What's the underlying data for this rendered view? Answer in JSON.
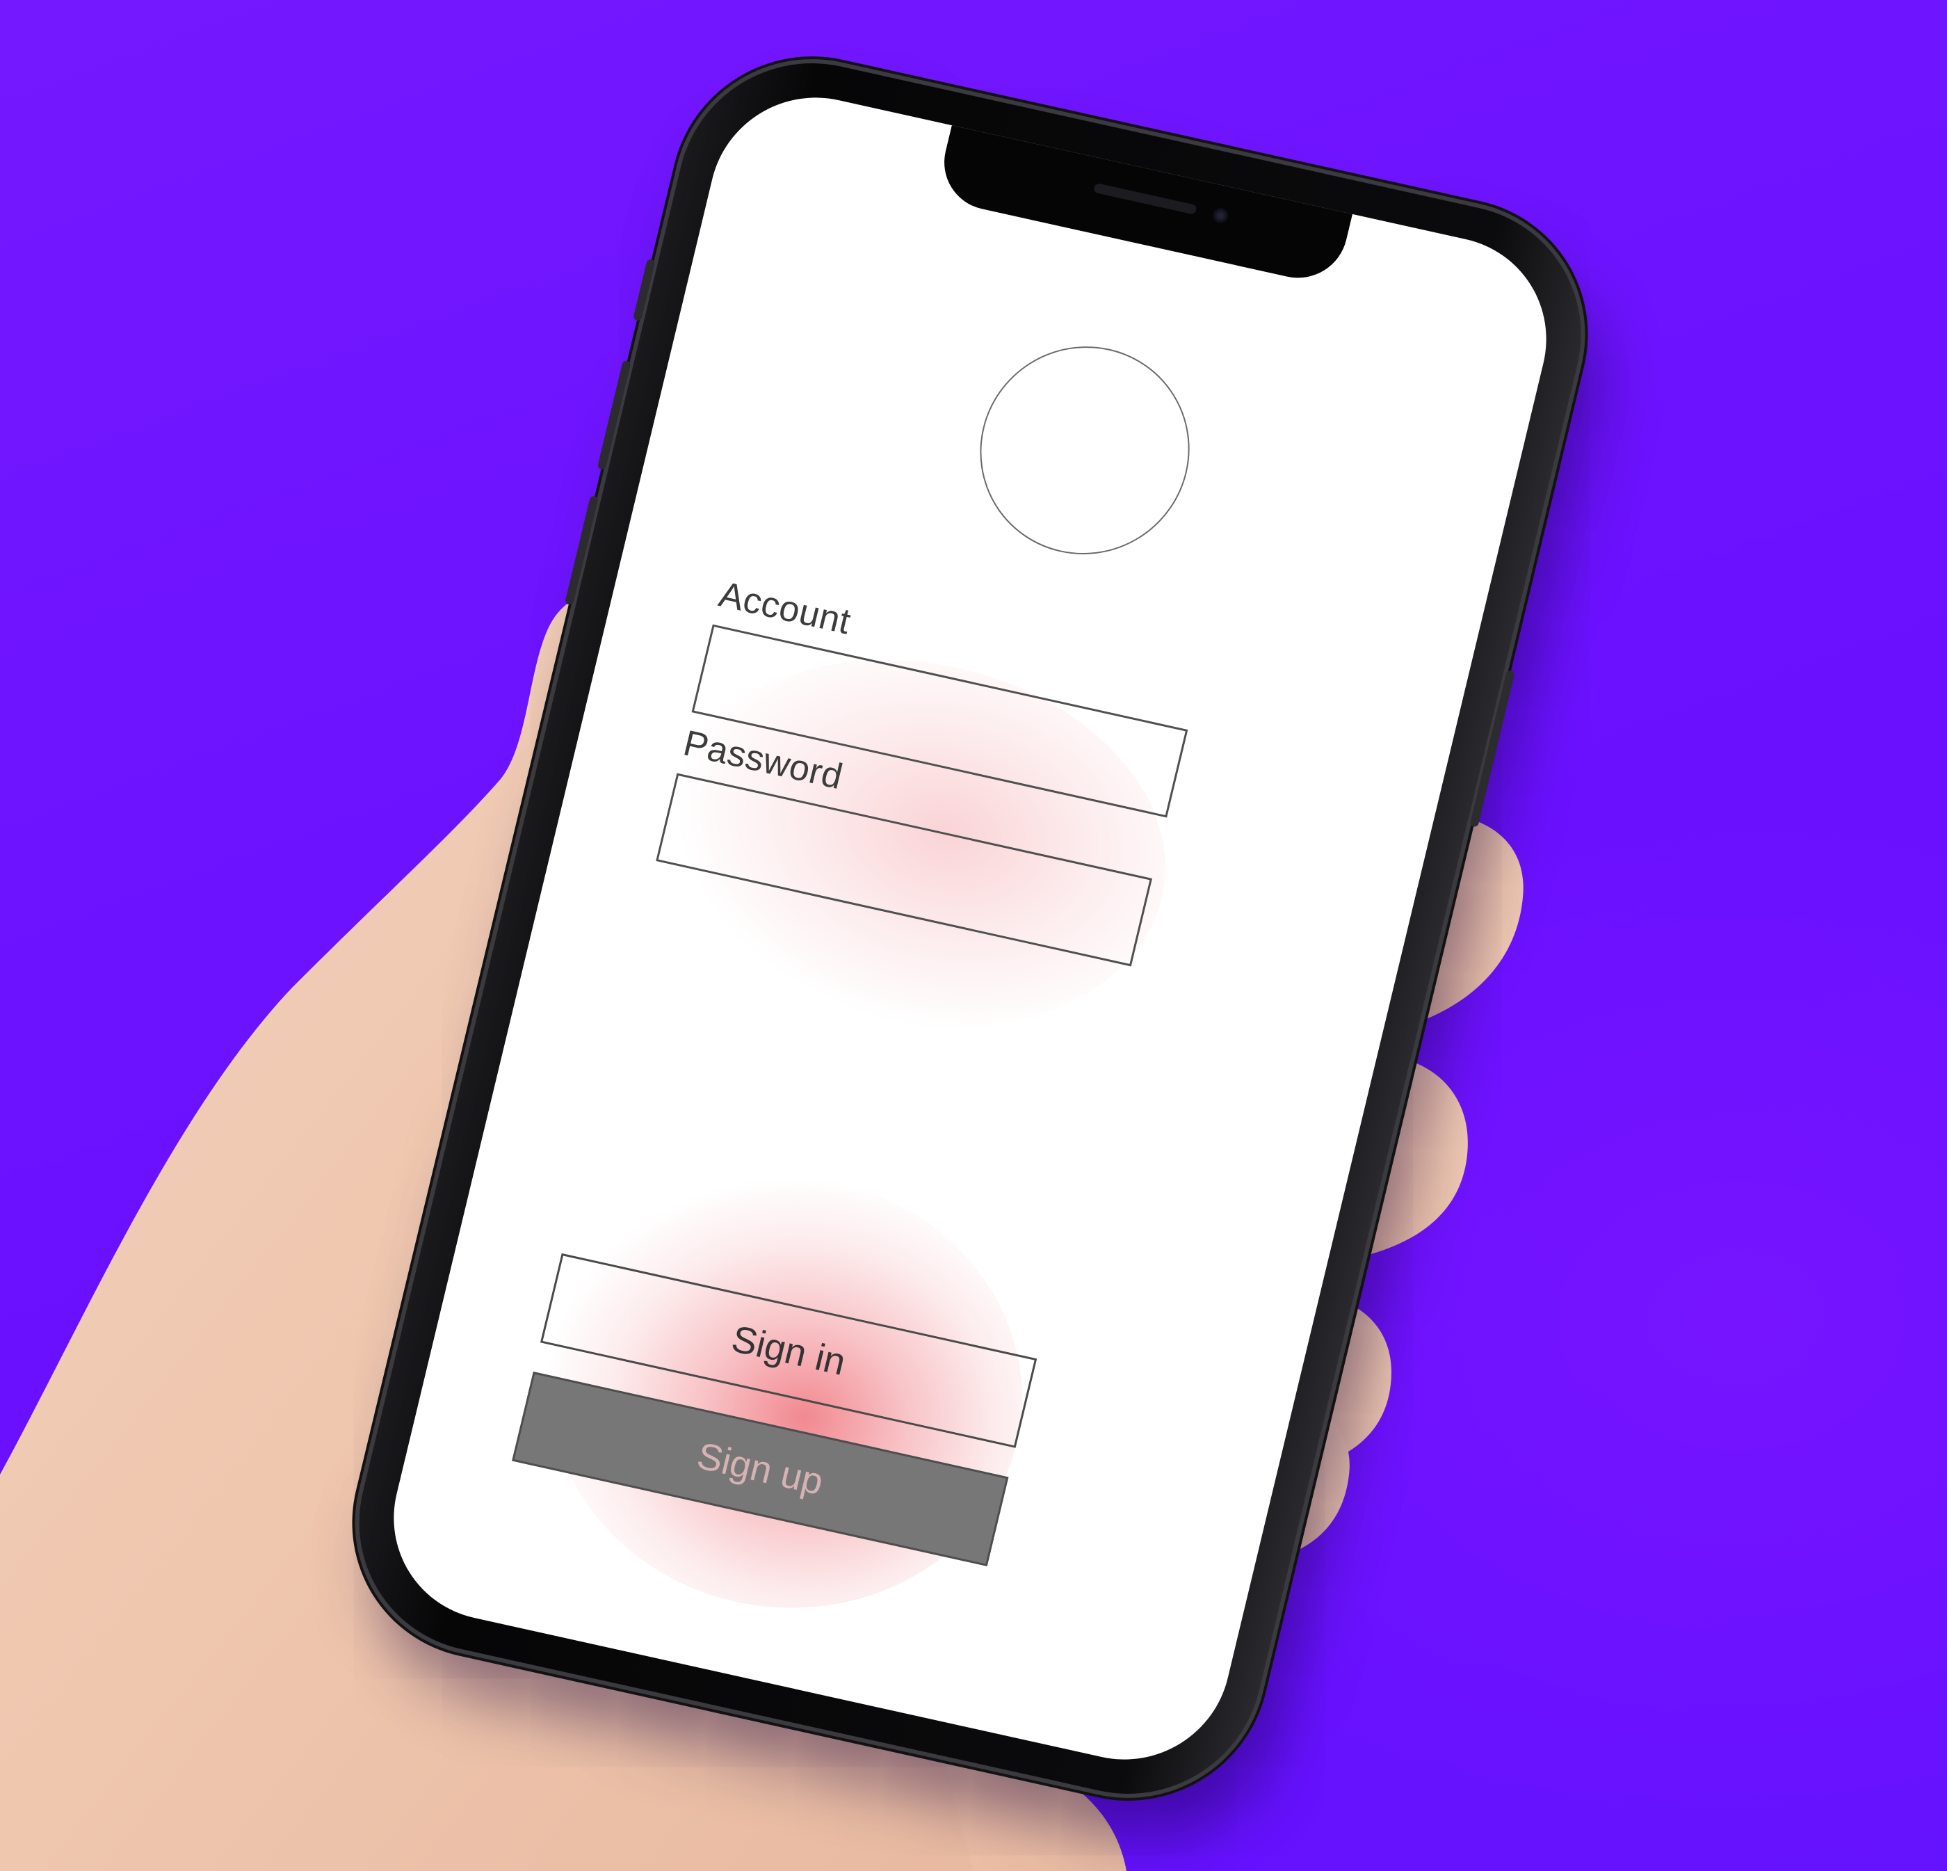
{
  "login": {
    "account_label": "Account",
    "account_value": "",
    "password_label": "Password",
    "password_value": "",
    "sign_in_label": "Sign in",
    "sign_up_label": "Sign up"
  },
  "colors": {
    "background": "#6f12ff",
    "screen": "#ffffff",
    "sign_up_fill": "#777777",
    "heatmap": "#e83a46"
  }
}
